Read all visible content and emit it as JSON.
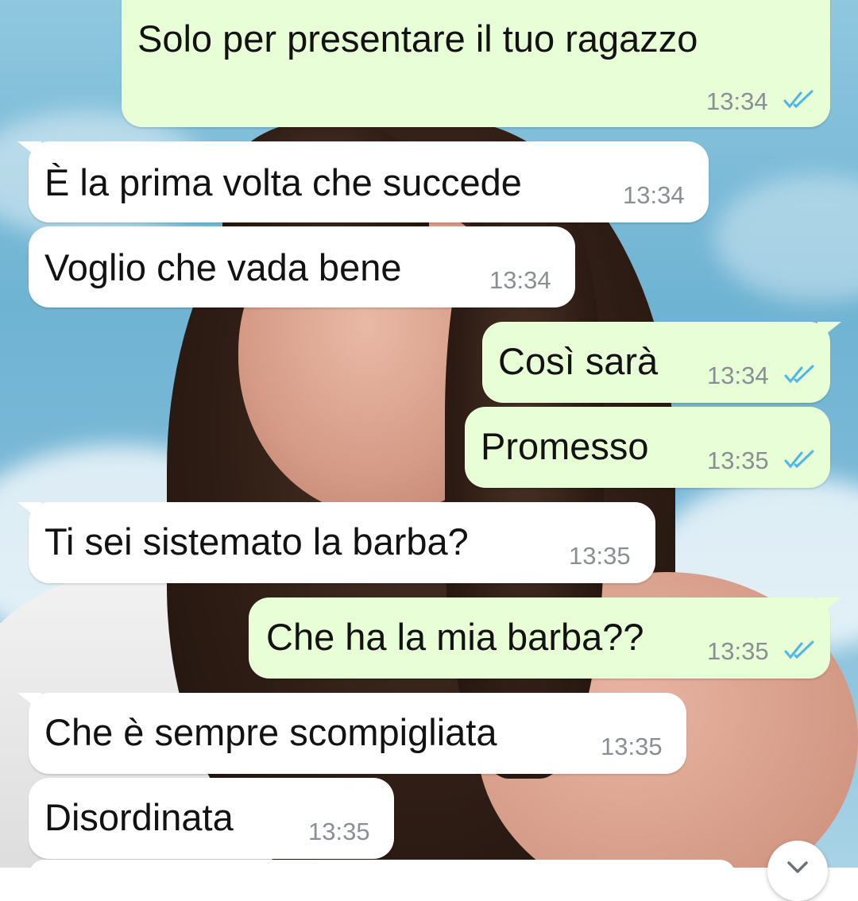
{
  "chat": {
    "messages": [
      {
        "direction": "outgoing",
        "text": "Solo per presentare il tuo ragazzo",
        "time": "13:34",
        "status": "read"
      },
      {
        "direction": "incoming",
        "text": "È la prima volta che succede",
        "time": "13:34"
      },
      {
        "direction": "incoming",
        "text": "Voglio che vada bene",
        "time": "13:34"
      },
      {
        "direction": "outgoing",
        "text": "Così sarà",
        "time": "13:34",
        "status": "read"
      },
      {
        "direction": "outgoing",
        "text": "Promesso",
        "time": "13:35",
        "status": "read"
      },
      {
        "direction": "incoming",
        "text": "Ti sei sistemato la barba?",
        "time": "13:35"
      },
      {
        "direction": "outgoing",
        "text": "Che ha la mia barba??",
        "time": "13:35",
        "status": "read"
      },
      {
        "direction": "incoming",
        "text": "Che è sempre scompigliata",
        "time": "13:35"
      },
      {
        "direction": "incoming",
        "text": "Disordinata",
        "time": "13:35"
      }
    ]
  },
  "colors": {
    "incoming_bubble": "#ffffff",
    "outgoing_bubble": "#e7fed7",
    "read_ticks": "#4fb6ec",
    "timestamp": "#8a8f93"
  },
  "icons": {
    "read_receipt": "double-check-icon",
    "scroll_down": "chevron-down-icon"
  }
}
